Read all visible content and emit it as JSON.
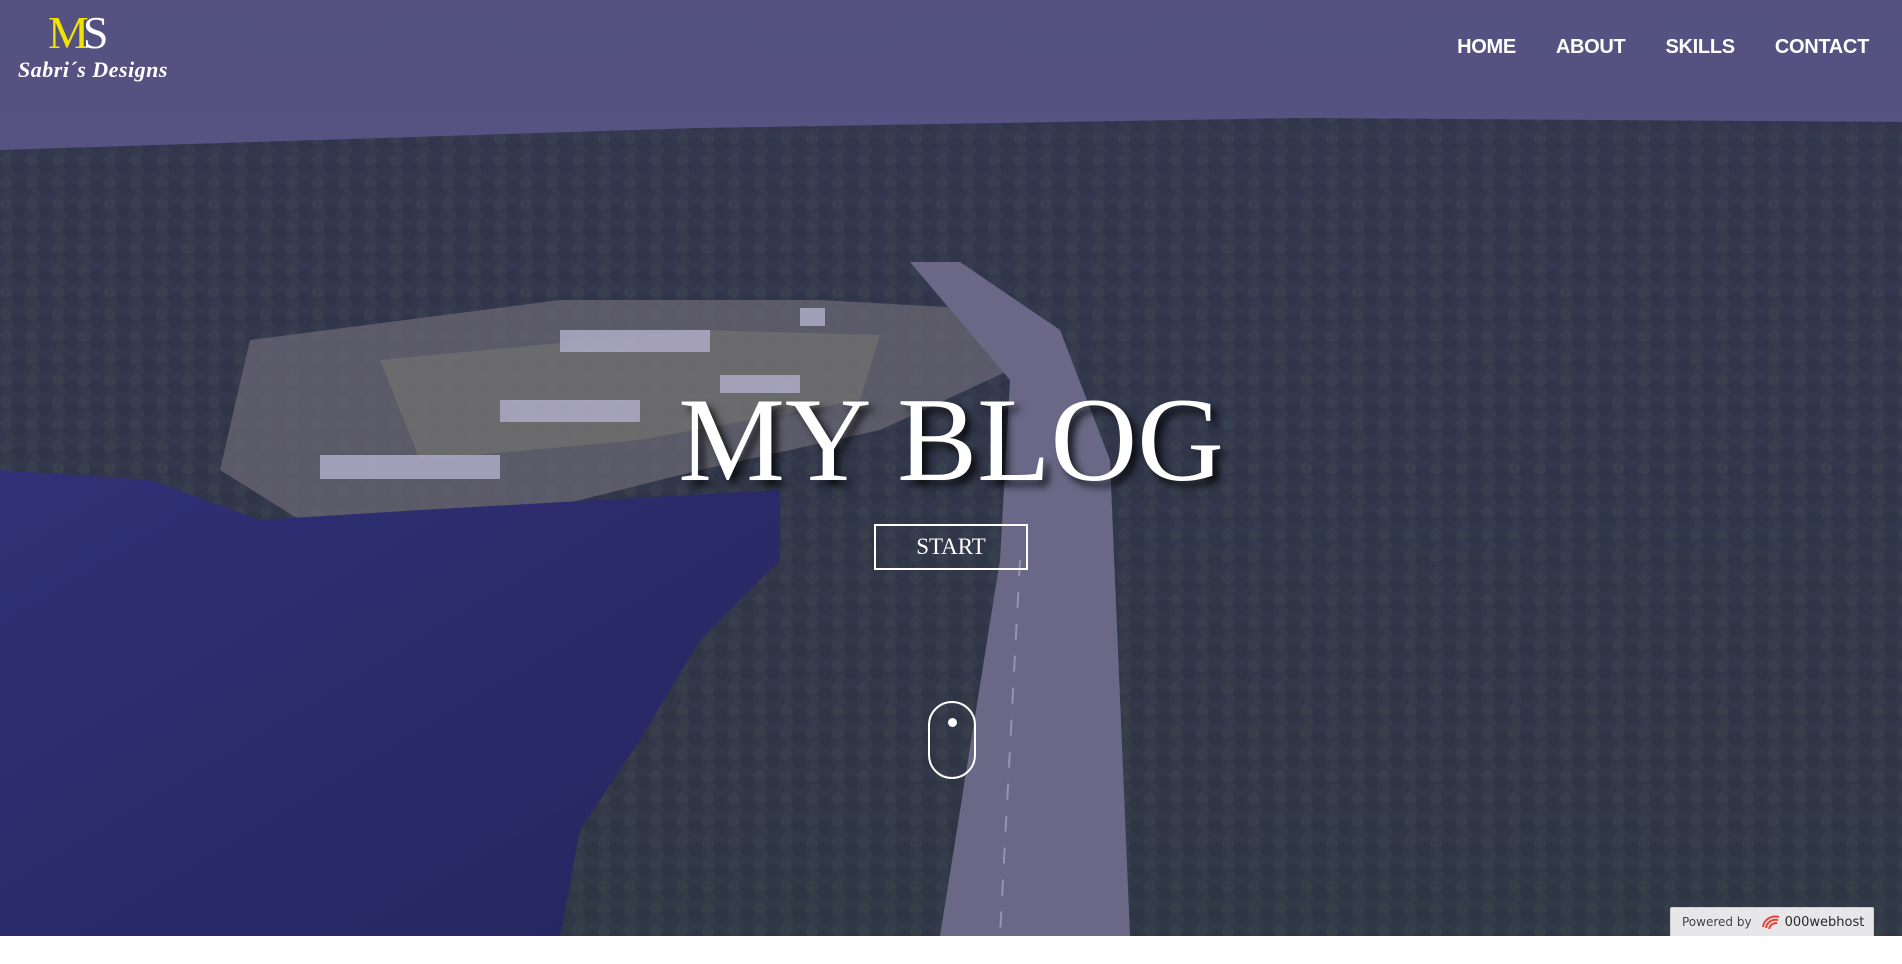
{
  "logo": {
    "mark_m": "M",
    "mark_s": "S",
    "text": "Sabri´s Designs"
  },
  "nav": {
    "items": [
      "HOME",
      "ABOUT",
      "SKILLS",
      "CONTACT"
    ]
  },
  "hero": {
    "title": "MY BLOG",
    "button_label": "START"
  },
  "icons": {
    "scroll": "mouse-scroll-icon",
    "host": "000webhost-logo-icon"
  },
  "footer_badge": {
    "label": "Powered by",
    "brand": "000webhost"
  },
  "colors": {
    "overlay": "#3c3778",
    "accent_logo": "#f2e200",
    "text": "#ffffff",
    "badge_bg": "#e7e7ea",
    "host_icon": "#e8443b"
  }
}
